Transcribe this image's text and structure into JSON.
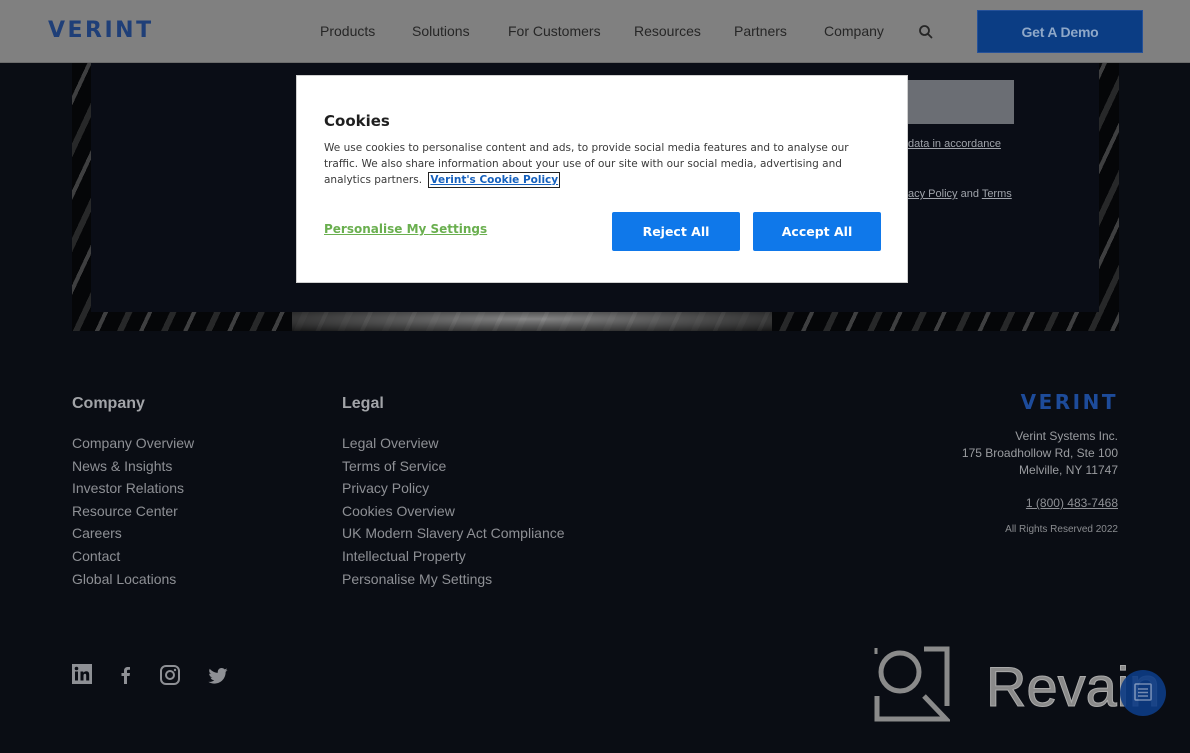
{
  "header": {
    "logo": "VERINT",
    "nav": [
      "Products",
      "Solutions",
      "For Customers",
      "Resources",
      "Partners",
      "Company"
    ],
    "search_icon": "search-icon",
    "demo_button": "Get A Demo"
  },
  "background_form": {
    "consent_line1": "data in accordance",
    "consent_line2_a": "acy Policy",
    "consent_line2_b": "and",
    "consent_line2_c": "Terms"
  },
  "cookie_modal": {
    "title": "Cookies",
    "body": "We use cookies to personalise content and ads, to provide social media features and to analyse our traffic. We also share information about your use of our site with our social media, advertising and analytics partners.",
    "policy_link": "Verint's Cookie Policy",
    "personalise_link": "Personalise My Settings",
    "reject_button": "Reject All",
    "accept_button": "Accept All"
  },
  "footer": {
    "company": {
      "heading": "Company",
      "links": [
        "Company Overview",
        "News & Insights",
        "Investor Relations",
        "Resource Center",
        "Careers",
        "Contact",
        "Global Locations"
      ]
    },
    "legal": {
      "heading": "Legal",
      "links": [
        "Legal Overview",
        "Terms of Service",
        "Privacy Policy",
        "Cookies Overview",
        "UK Modern Slavery Act Compliance",
        "Intellectual Property",
        "Personalise My Settings"
      ]
    },
    "logo": "VERINT",
    "address": [
      "Verint Systems Inc.",
      "175 Broadhollow Rd, Ste 100",
      "Melville, NY 11747"
    ],
    "phone": "1 (800) 483-7468",
    "rights": "All Rights Reserved 2022",
    "social": [
      "linkedin-icon",
      "facebook-icon",
      "instagram-icon",
      "twitter-icon"
    ]
  },
  "watermark": {
    "text": "Revain"
  },
  "colors": {
    "brand_blue": "#0b3d84",
    "button_blue": "#0f78ea",
    "link_green": "#6aaf4f",
    "background": "#0a0d14"
  }
}
